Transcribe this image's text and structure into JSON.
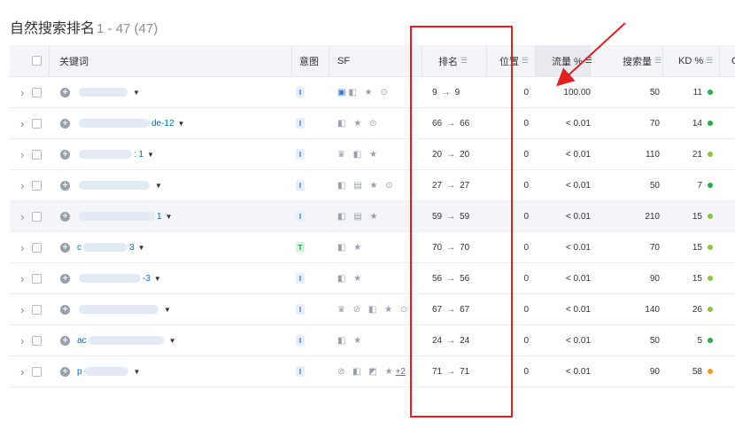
{
  "page": {
    "title": "自然搜索排名",
    "count": "1 - 47 (47)"
  },
  "header": {
    "keyword": "关键词",
    "intent": "意图",
    "sf": "SF",
    "rank": "排名",
    "position": "位置",
    "traffic": "流量 %",
    "volume": "搜索量",
    "kd": "KD %",
    "extra": "C"
  },
  "rows": [
    {
      "kw_pre": "",
      "kw_suf": "",
      "blur": 55,
      "intent": "I",
      "sf": "▣ ◧ ★ ⊙",
      "sf_blue": true,
      "rank_from": "9",
      "rank_to": "9",
      "pos": "0",
      "traffic": "100.00",
      "volume": "50",
      "kd": "11",
      "kd_color": "#2ca94a",
      "hl": false
    },
    {
      "kw_pre": "",
      "kw_suf": "de-12",
      "blur": 80,
      "intent": "I",
      "sf": "◧ ★ ⊙",
      "sf_blue": false,
      "rank_from": "66",
      "rank_to": "66",
      "pos": "0",
      "traffic": "< 0.01",
      "volume": "70",
      "kd": "14",
      "kd_color": "#2ca94a",
      "hl": false
    },
    {
      "kw_pre": "",
      "kw_suf": ": 1",
      "blur": 60,
      "intent": "I",
      "sf": "♛ ◧ ★",
      "sf_blue": false,
      "rank_from": "20",
      "rank_to": "20",
      "pos": "0",
      "traffic": "< 0.01",
      "volume": "110",
      "kd": "21",
      "kd_color": "#8ac43f",
      "hl": false
    },
    {
      "kw_pre": "",
      "kw_suf": "",
      "blur": 80,
      "intent": "I",
      "sf": "◧ ▤ ★ ⊙",
      "sf_blue": false,
      "rank_from": "27",
      "rank_to": "27",
      "pos": "0",
      "traffic": "< 0.01",
      "volume": "50",
      "kd": "7",
      "kd_color": "#2ca94a",
      "hl": false
    },
    {
      "kw_pre": "",
      "kw_suf": "1",
      "blur": 86,
      "intent": "I",
      "sf": "◧ ▤ ★",
      "sf_blue": false,
      "rank_from": "59",
      "rank_to": "59",
      "pos": "0",
      "traffic": "< 0.01",
      "volume": "210",
      "kd": "15",
      "kd_color": "#8ac43f",
      "hl": true
    },
    {
      "kw_pre": "c",
      "kw_suf": "3",
      "blur": 50,
      "intent": "T",
      "sf": "◧ ★",
      "sf_blue": false,
      "rank_from": "70",
      "rank_to": "70",
      "pos": "0",
      "traffic": "< 0.01",
      "volume": "70",
      "kd": "15",
      "kd_color": "#8ac43f",
      "hl": false
    },
    {
      "kw_pre": "",
      "kw_suf": "-3",
      "blur": 70,
      "intent": "I",
      "sf": "◧ ★",
      "sf_blue": false,
      "rank_from": "56",
      "rank_to": "56",
      "pos": "0",
      "traffic": "< 0.01",
      "volume": "90",
      "kd": "15",
      "kd_color": "#8ac43f",
      "hl": false
    },
    {
      "kw_pre": "",
      "kw_suf": "",
      "blur": 90,
      "intent": "I",
      "sf": "♛ ⊘ ◧ ★ ⊙",
      "sf_blue": false,
      "rank_from": "67",
      "rank_to": "67",
      "pos": "0",
      "traffic": "< 0.01",
      "volume": "140",
      "kd": "26",
      "kd_color": "#8ac43f",
      "hl": false
    },
    {
      "kw_pre": "ac",
      "kw_suf": "",
      "blur": 85,
      "intent": "I",
      "sf": "◧ ★",
      "sf_blue": false,
      "rank_from": "24",
      "rank_to": "24",
      "pos": "0",
      "traffic": "< 0.01",
      "volume": "50",
      "kd": "5",
      "kd_color": "#2ca94a",
      "hl": false
    },
    {
      "kw_pre": "p",
      "kw_suf": "",
      "blur": 50,
      "intent": "I",
      "sf": "⊘ ◧ ◩ ★",
      "sf_blue": false,
      "sf_more": "+2",
      "rank_from": "71",
      "rank_to": "71",
      "pos": "0",
      "traffic": "< 0.01",
      "volume": "90",
      "kd": "58",
      "kd_color": "#f39a2b",
      "hl": false
    }
  ]
}
